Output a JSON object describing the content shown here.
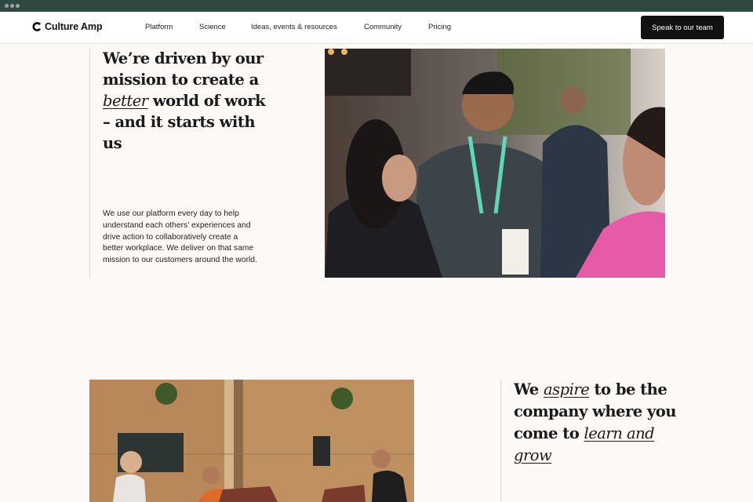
{
  "brand": {
    "name": "Culture Amp"
  },
  "nav": {
    "items": [
      "Platform",
      "Science",
      "Ideas, events & resources",
      "Community",
      "Pricing"
    ],
    "cta": "Speak to our team"
  },
  "mission": {
    "heading_before": "We’re driven by our mission to create a ",
    "heading_emphasis": "better",
    "heading_after": " world of work – and it starts with us",
    "body": "We use our platform every day to help understand each others’ experiences and drive action to collaboratively create a better workplace. We deliver on that same mission to our customers around the world."
  },
  "aspire": {
    "heading_1": "We ",
    "emphasis_1": "aspire",
    "heading_2": " to be the company where you come to ",
    "emphasis_2": "learn and grow"
  },
  "colors": {
    "chrome": "#2f4942",
    "background": "#fdf9f6",
    "cta": "#111111"
  }
}
